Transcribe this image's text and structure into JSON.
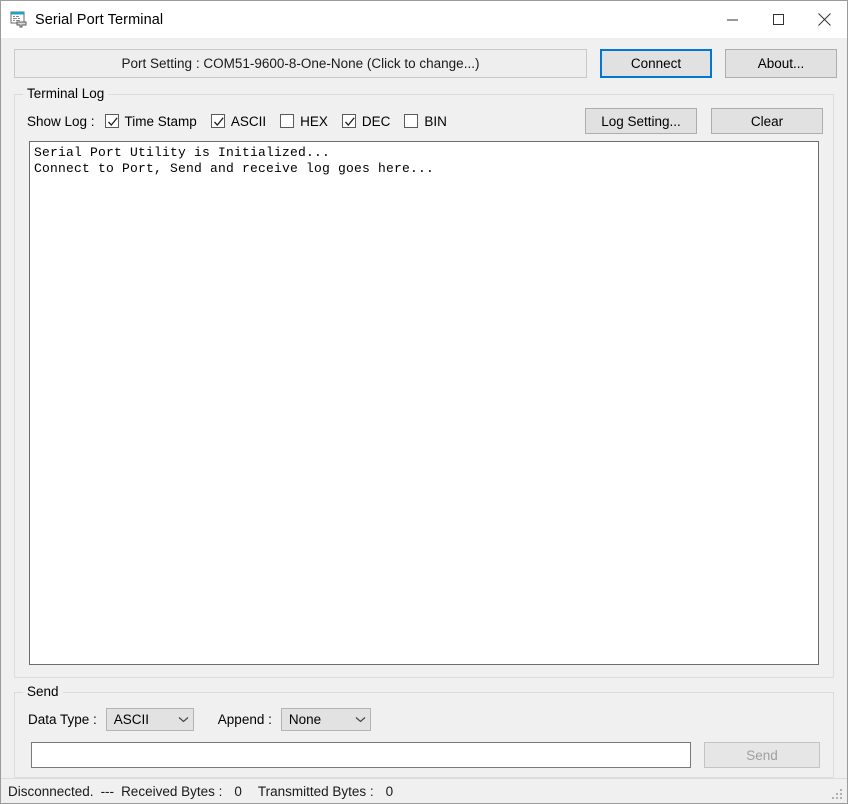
{
  "window": {
    "title": "Serial Port Terminal",
    "icon": "serial-terminal-icon",
    "controls": {
      "minimize": "minimize-icon",
      "maximize": "maximize-icon",
      "close": "close-icon"
    }
  },
  "toolbar": {
    "port_setting_label": "Port Setting : COM51-9600-8-One-None (Click to change...)",
    "connect_label": "Connect",
    "about_label": "About..."
  },
  "terminal_log": {
    "group_title": "Terminal Log",
    "show_log_label": "Show Log :",
    "checkboxes": [
      {
        "label": "Time Stamp",
        "checked": true
      },
      {
        "label": "ASCII",
        "checked": true
      },
      {
        "label": "HEX",
        "checked": false
      },
      {
        "label": "DEC",
        "checked": true
      },
      {
        "label": "BIN",
        "checked": false
      }
    ],
    "log_setting_label": "Log Setting...",
    "clear_label": "Clear",
    "log_lines": [
      "Serial Port Utility is Initialized...",
      "Connect to Port, Send and receive log goes here..."
    ]
  },
  "send": {
    "group_title": "Send",
    "data_type_label": "Data Type :",
    "data_type_value": "ASCII",
    "data_type_options": [
      "ASCII"
    ],
    "append_label": "Append :",
    "append_value": "None",
    "append_options": [
      "None"
    ],
    "input_value": "",
    "input_placeholder": "",
    "send_label": "Send",
    "send_enabled": false
  },
  "status_bar": {
    "connection": "Disconnected.",
    "separator": "---",
    "received_label": "Received Bytes :",
    "received_value": "0",
    "transmitted_label": "Transmitted Bytes :",
    "transmitted_value": "0"
  },
  "colors": {
    "accent_focus": "#0078d7",
    "window_bg": "#f0f0f0",
    "titlebar_bg": "#ffffff",
    "log_bg": "#ffffff",
    "button_bg": "#e1e1e1"
  }
}
